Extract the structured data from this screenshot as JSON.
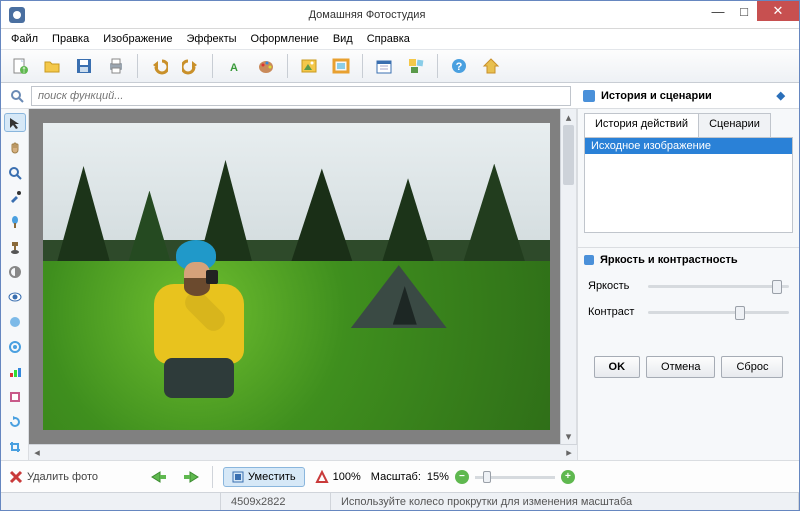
{
  "window": {
    "title": "Домашняя Фотостудия"
  },
  "menu": [
    "Файл",
    "Правка",
    "Изображение",
    "Эффекты",
    "Оформление",
    "Вид",
    "Справка"
  ],
  "toolbar_icons": [
    "new-file",
    "open-folder",
    "save-disk",
    "print",
    "undo",
    "redo",
    "text-tool",
    "palette",
    "picture",
    "picture-frame",
    "calendar",
    "collage",
    "help",
    "home"
  ],
  "search": {
    "placeholder": "поиск функций..."
  },
  "history_panel": {
    "title": "История и сценарии",
    "tabs": [
      "История действий",
      "Сценарии"
    ],
    "items": [
      "Исходное изображение"
    ]
  },
  "brightness_panel": {
    "title": "Яркость и контрастность",
    "brightness_label": "Яркость",
    "contrast_label": "Контраст",
    "brightness_value": 88,
    "contrast_value": 62,
    "ok": "OK",
    "cancel": "Отмена",
    "reset": "Сброс"
  },
  "left_tools": [
    "pointer",
    "hand",
    "zoom",
    "color-picker",
    "brush",
    "clone-stamp",
    "dodge",
    "eye-correction",
    "blur",
    "sharpen",
    "levels",
    "filters",
    "rotate",
    "crop"
  ],
  "bottom": {
    "delete": "Удалить фото",
    "fit": "Уместить",
    "zoom_label": "100%",
    "scale_prefix": "Масштаб:",
    "scale_value": "15%"
  },
  "status": {
    "dimensions": "4509x2822",
    "hint": "Используйте колесо прокрутки для изменения масштаба"
  },
  "colors": {
    "accent": "#2a81d7",
    "green": "#5fb84f",
    "red": "#c93a3a",
    "yellow": "#e8c31e"
  }
}
